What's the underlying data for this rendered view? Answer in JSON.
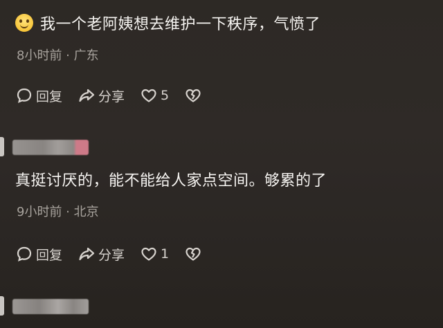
{
  "comments": [
    {
      "text": "我一个老阿姨想去维护一下秩序，气愤了",
      "has_emoji": true,
      "emoji_icon": "smiley-face-icon",
      "time": "8小时前",
      "location": "广东",
      "meta": "8小时前 · 广东",
      "reply_label": "回复",
      "share_label": "分享",
      "like_count": "5"
    },
    {
      "text": "真挺讨厌的，能不能给人家点空间。够累的了",
      "has_emoji": false,
      "time": "9小时前",
      "location": "北京",
      "meta": "9小时前 · 北京",
      "reply_label": "回复",
      "share_label": "分享",
      "like_count": "1"
    }
  ],
  "icons": {
    "reply": "reply-bubble-icon",
    "share": "share-arrow-icon",
    "like": "heart-icon",
    "dislike": "broken-heart-icon"
  },
  "colors": {
    "background": "#2d2925",
    "text": "#f7f5f2",
    "meta": "#a8a39d",
    "actions": "#d8d4cf"
  }
}
